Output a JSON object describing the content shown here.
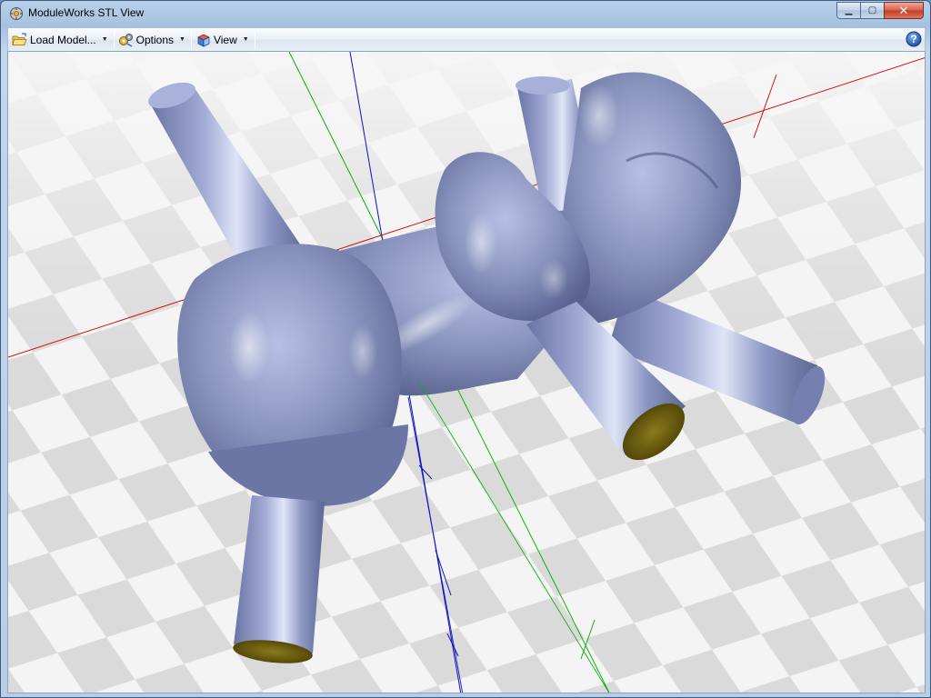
{
  "window": {
    "title": "ModuleWorks STL View",
    "icons": {
      "app": "moduleworks-app-icon",
      "minimize": "minimize-icon",
      "maximize": "maximize-icon",
      "close": "close-icon"
    },
    "caption_glyphs": {
      "minimize": "▁",
      "maximize": "▢",
      "close": "✕"
    }
  },
  "toolbar": {
    "load_model_label": "Load Model...",
    "options_label": "Options",
    "view_label": "View",
    "help_icon": "help-icon"
  },
  "viewport": {
    "content": "3D STL model of a dental bridge with support cylinders on a checkerboard floor",
    "colors": {
      "background": "#f3f3f3",
      "checker_dark": "#d9d9d9",
      "model_fill": "#8893bd",
      "model_highlight": "#dfe5f7",
      "cut_face": "#6b5b12",
      "x_axis": "#d01010",
      "y_axis": "#10b010",
      "z_axis": "#1010c0"
    }
  }
}
